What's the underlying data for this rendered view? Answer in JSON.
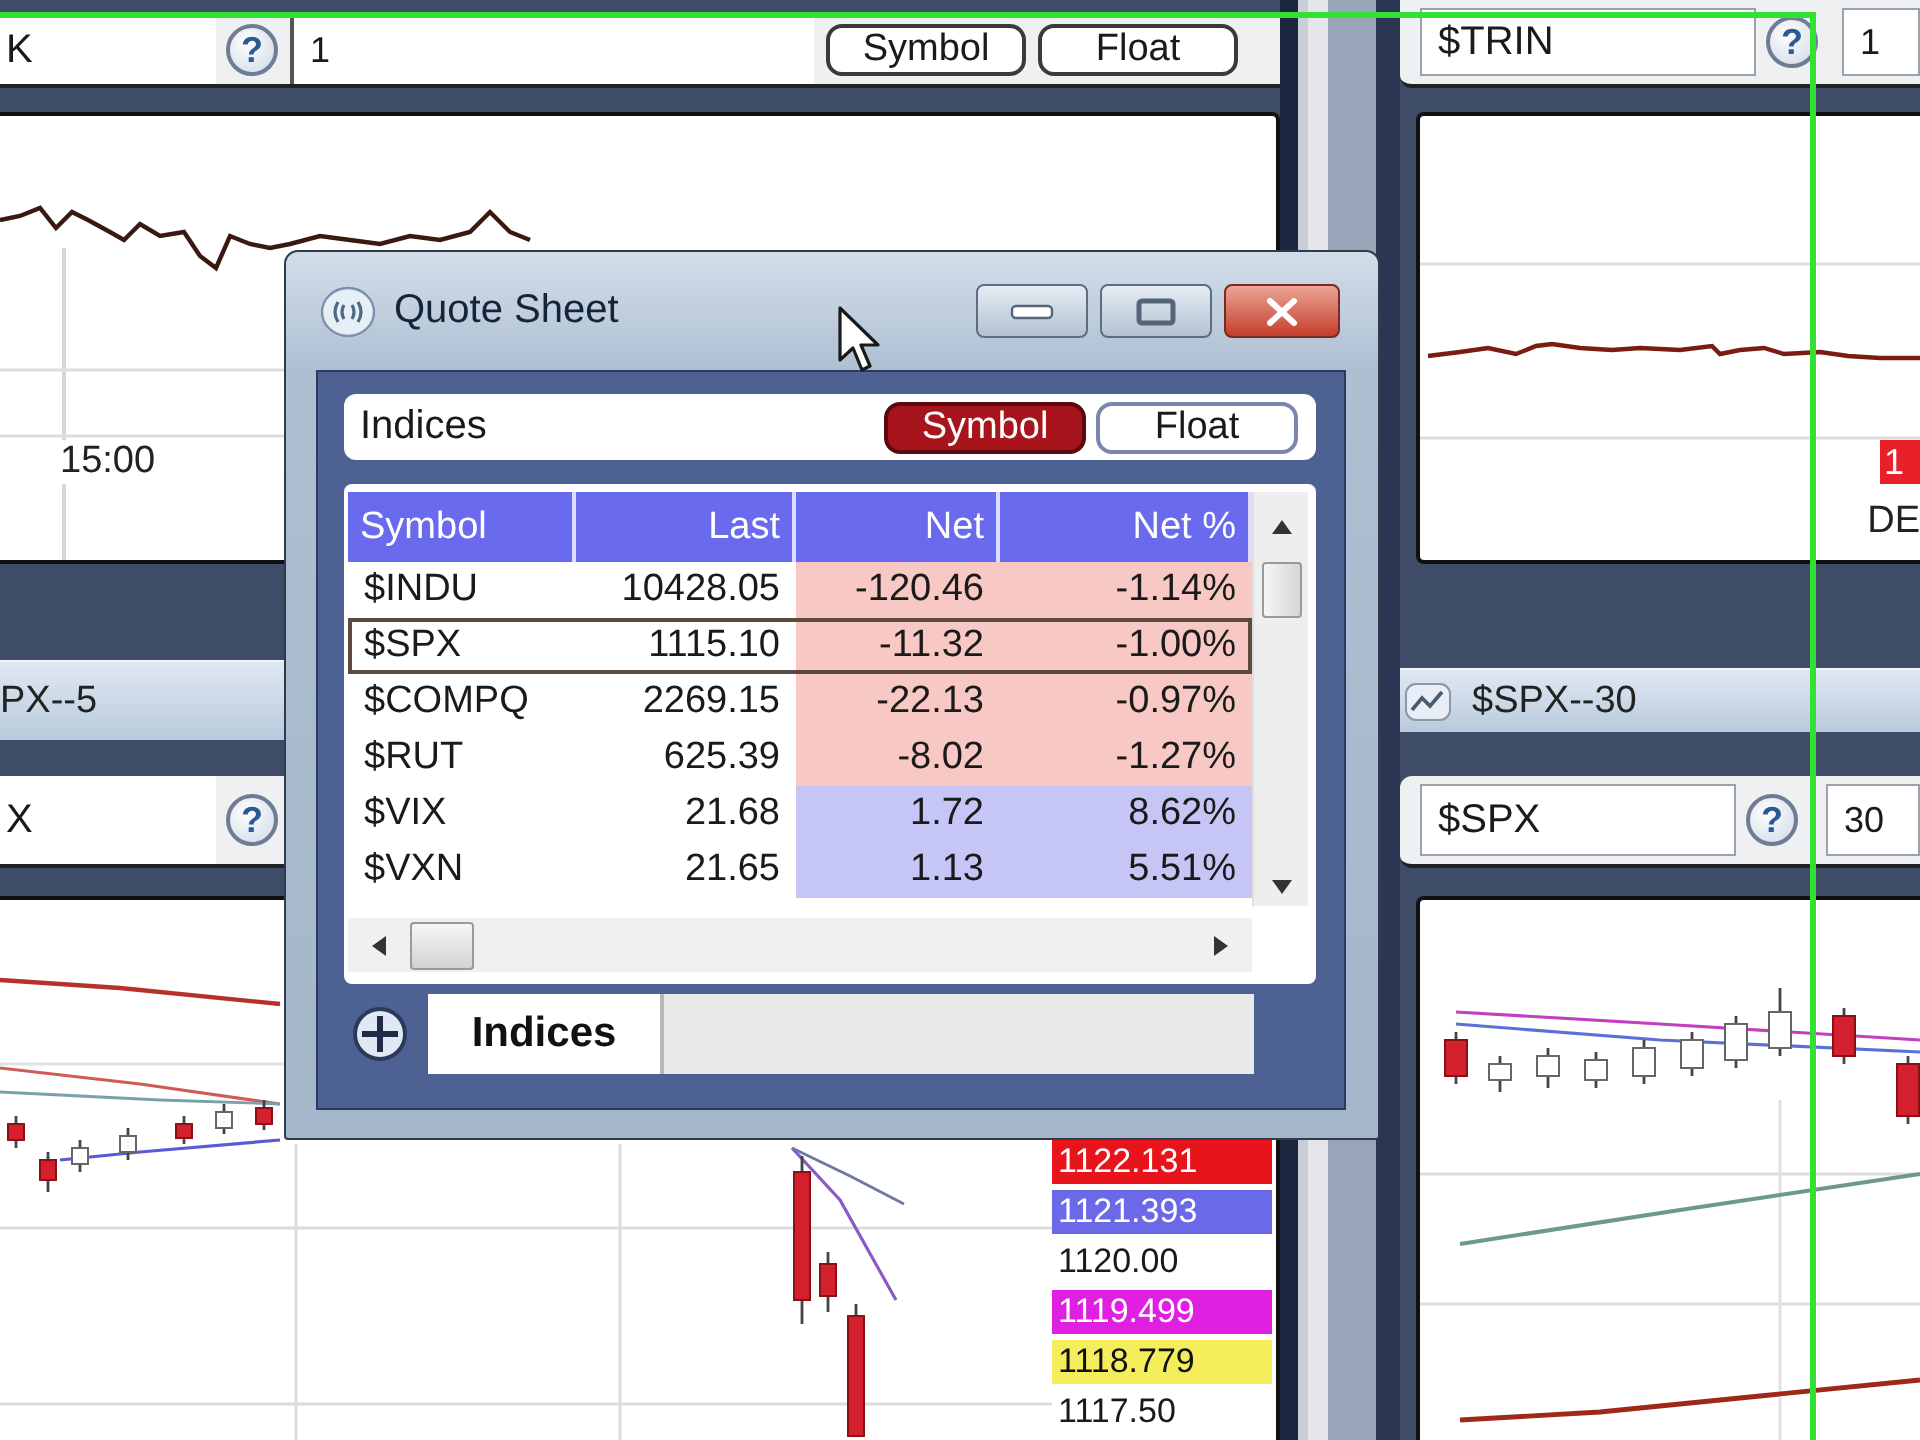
{
  "chart_panels": {
    "top_left": {
      "symbol": "K",
      "help": "?",
      "interval": "1",
      "link_buttons": [
        {
          "label": "Symbol",
          "selected": false
        },
        {
          "label": "Float",
          "selected": false
        }
      ],
      "time_label": "15:00"
    },
    "top_right": {
      "symbol": "$TRIN",
      "help": "?",
      "interval": "1",
      "price_marker": "1",
      "axis_label": "DE"
    },
    "bottom_left": {
      "title": "PX--5",
      "symbol": "X",
      "help": "?",
      "price_labels": [
        {
          "text": "1122.131",
          "color": "#e8141c"
        },
        {
          "text": "1121.393",
          "color": "#6a6ae8"
        },
        {
          "text": "1120.00"
        },
        {
          "text": "1119.499",
          "color": "#e020e0"
        },
        {
          "text": "1118.779",
          "color": "#f4ee5c"
        },
        {
          "text": "1117.50"
        }
      ]
    },
    "bottom_right": {
      "title": "$SPX--30",
      "symbol": "$SPX",
      "help": "?",
      "interval": "30"
    }
  },
  "quote_sheet": {
    "title": "Quote Sheet",
    "list_name": "Indices",
    "link_buttons": [
      {
        "label": "Symbol",
        "selected": true
      },
      {
        "label": "Float",
        "selected": false
      }
    ],
    "columns": [
      "Symbol",
      "Last",
      "Net",
      "Net %"
    ],
    "rows": [
      {
        "symbol": "$INDU",
        "last": "10428.05",
        "net": "-120.46",
        "net_pct": "-1.14%",
        "falling": true,
        "selected": false
      },
      {
        "symbol": "$SPX",
        "last": "1115.10",
        "net": "-11.32",
        "net_pct": "-1.00%",
        "falling": true,
        "selected": true
      },
      {
        "symbol": "$COMPQ",
        "last": "2269.15",
        "net": "-22.13",
        "net_pct": "-0.97%",
        "falling": true,
        "selected": false
      },
      {
        "symbol": "$RUT",
        "last": "625.39",
        "net": "-8.02",
        "net_pct": "-1.27%",
        "falling": true,
        "selected": false
      },
      {
        "symbol": "$VIX",
        "last": "21.68",
        "net": "1.72",
        "net_pct": "8.62%",
        "falling": false,
        "selected": false
      },
      {
        "symbol": "$VXN",
        "last": "21.65",
        "net": "1.13",
        "net_pct": "5.51%",
        "falling": false,
        "selected": false
      }
    ],
    "tabs": [
      {
        "label": "Indices",
        "selected": true
      }
    ]
  }
}
